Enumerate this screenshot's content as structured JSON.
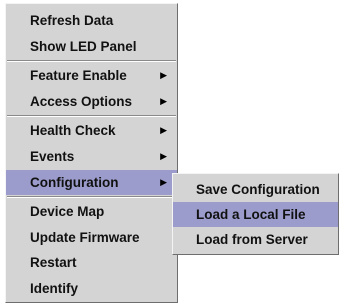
{
  "context_menu": {
    "groups": [
      [
        {
          "label": "Refresh Data",
          "submenu": false
        },
        {
          "label": "Show LED Panel",
          "submenu": false
        }
      ],
      [
        {
          "label": "Feature Enable",
          "submenu": true
        },
        {
          "label": "Access Options",
          "submenu": true
        }
      ],
      [
        {
          "label": "Health Check",
          "submenu": true
        },
        {
          "label": "Events",
          "submenu": true
        },
        {
          "label": "Configuration",
          "submenu": true,
          "highlighted": true
        }
      ],
      [
        {
          "label": "Device Map",
          "submenu": false
        },
        {
          "label": "Update Firmware",
          "submenu": false
        },
        {
          "label": "Restart",
          "submenu": false
        },
        {
          "label": "Identify",
          "submenu": false
        }
      ]
    ],
    "submenu_arrow_icon": "chevron-right-icon"
  },
  "configuration_submenu": {
    "items": [
      {
        "label": "Save Configuration"
      },
      {
        "label": "Load a Local File",
        "highlighted": true
      },
      {
        "label": "Load from Server"
      }
    ]
  },
  "colors": {
    "menu_background": "#d4d4d4",
    "highlight": "#9c9ccc",
    "text": "#111111"
  }
}
